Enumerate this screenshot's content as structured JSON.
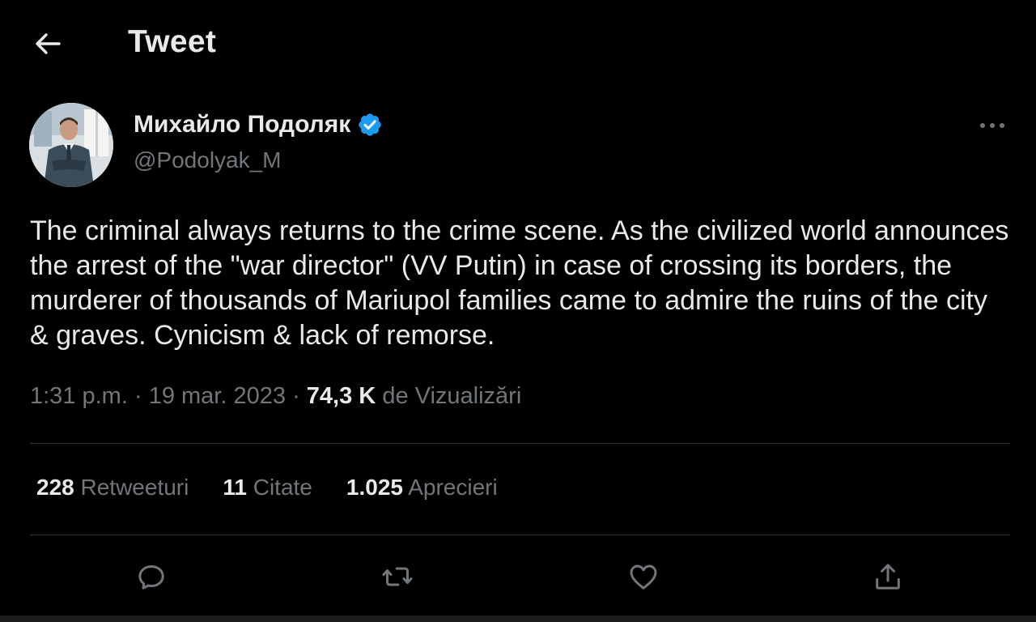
{
  "header": {
    "title": "Tweet",
    "back_icon": "arrow-left-icon"
  },
  "author": {
    "name": "Михайло Подоляк",
    "handle": "@Podolyak_M",
    "verified": true,
    "verified_color": "#1d9bf0",
    "more_icon": "more-horizontal-icon"
  },
  "tweet": {
    "text": "The criminal always returns to the crime scene. As the civilized world announces the arrest of the \"war director\" (VV Putin) in case of crossing its borders, the murderer of thousands of Mariupol families came to admire the ruins of the city & graves. Cynicism & lack of remorse.",
    "time": "1:31 p.m.",
    "separator": "·",
    "date": "19 mar. 2023",
    "views_count": "74,3 K",
    "views_label": "de Vizualizări"
  },
  "stats": {
    "retweets_count": "228",
    "retweets_label": "Retweeturi",
    "quotes_count": "11",
    "quotes_label": "Citate",
    "likes_count": "1.025",
    "likes_label": "Aprecieri"
  },
  "actions": [
    "reply-icon",
    "retweet-icon",
    "like-icon",
    "share-icon"
  ],
  "colors": {
    "background": "#000000",
    "text": "#e7e9ea",
    "secondary_text": "#71767b",
    "divider": "#2f3336",
    "accent": "#1d9bf0"
  }
}
